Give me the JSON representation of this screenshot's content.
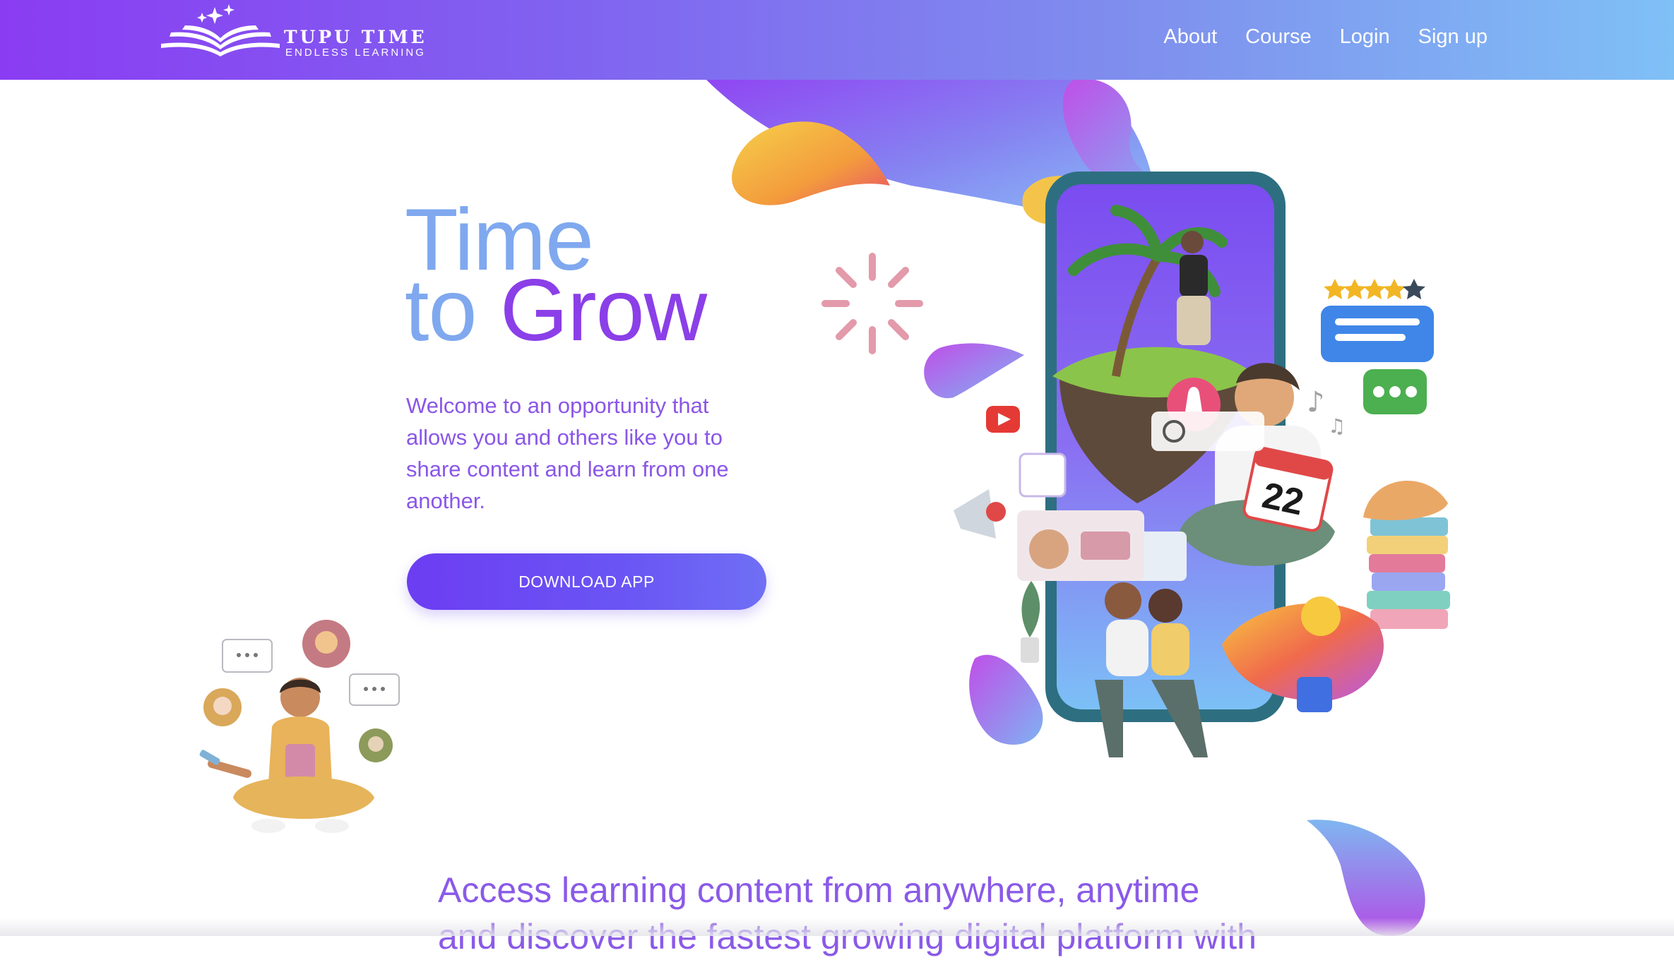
{
  "brand": {
    "name": "TUPU TIME",
    "tagline": "ENDLESS LEARNING",
    "icon": "open-book-sparkles-logo"
  },
  "nav": {
    "links": [
      {
        "label": "About"
      },
      {
        "label": "Course"
      },
      {
        "label": "Login"
      },
      {
        "label": "Sign up"
      }
    ]
  },
  "hero": {
    "title_line1": "Time",
    "title_line2_a": "to",
    "title_line2_b": "Grow",
    "intro": "Welcome to an opportunity that allows you and others like you to share content and learn from one another.",
    "cta_label": "DOWNLOAD APP",
    "calendar_day": "22"
  },
  "tagline": {
    "line1": "Access learning content from anywhere, anytime",
    "line2": "and discover the fastest growing digital platform with"
  },
  "colors": {
    "nav_gradient_start": "#8a3cf2",
    "nav_gradient_end": "#7fc0f6",
    "title_blue": "#7fa8ef",
    "title_purple": "#8b3fe8",
    "text_purple": "#8a56e8",
    "button": "#6c3df2"
  }
}
